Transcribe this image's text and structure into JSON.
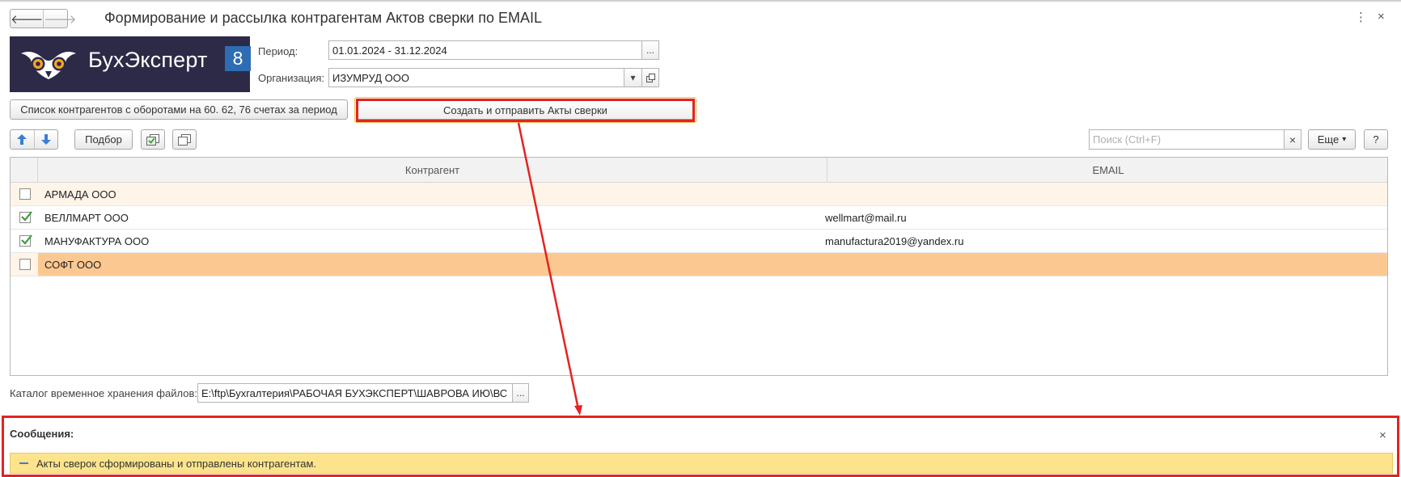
{
  "window": {
    "title": "Формирование и рассылка контрагентам Актов сверки по EMAIL",
    "nav_back": "🡐",
    "nav_forward": "🡒",
    "menu_icon": "⋮",
    "close_icon": "×"
  },
  "logo": {
    "text": "БухЭксперт",
    "badge": "8"
  },
  "form": {
    "period_label": "Период:",
    "period_value": "01.01.2024 - 31.12.2024",
    "period_select": "...",
    "org_label": "Организация:",
    "org_value": "ИЗУМРУД ООО",
    "org_dropdown": "▾",
    "catalog_label": "Каталог временное хранения файлов:",
    "catalog_value": "E:\\ftp\\Бухгалтерия\\РАБОЧАЯ БУХЭКСПЕРТ\\ШАВРОВА ИЮ\\ВС",
    "catalog_select": "..."
  },
  "buttons": {
    "counterparties_list": "Список контрагентов с оборотами на 60. 62, 76 счетах за период",
    "create_send": "Создать и отправить Акты сверки",
    "pick": "Подбор",
    "more": "Еще",
    "more_arrow": "▾",
    "help": "?"
  },
  "search": {
    "placeholder": "Поиск (Ctrl+F)",
    "clear": "×"
  },
  "table": {
    "columns": [
      "Контрагент",
      "EMAIL"
    ],
    "rows": [
      {
        "checked": false,
        "name": "АРМАДА ООО",
        "email": ""
      },
      {
        "checked": true,
        "name": "ВЕЛЛМАРТ ООО",
        "email": "wellmart@mail.ru"
      },
      {
        "checked": true,
        "name": "МАНУФАКТУРА ООО",
        "email": "manufactura2019@yandex.ru"
      },
      {
        "checked": false,
        "name": "СОФТ ООО",
        "email": ""
      }
    ]
  },
  "messages": {
    "title": "Сообщения:",
    "close": "×",
    "items": [
      {
        "text": "Акты сверок сформированы и отправлены контрагентам."
      }
    ]
  },
  "colors": {
    "logo_bg": "#2c2a47",
    "logo_badge": "#2e6cb3",
    "row_current": "#fcc891",
    "row_highlight": "#fff4e8",
    "message_bg": "#fde48c",
    "annotation_red": "#e52222",
    "check_green": "#3f9a3a"
  }
}
